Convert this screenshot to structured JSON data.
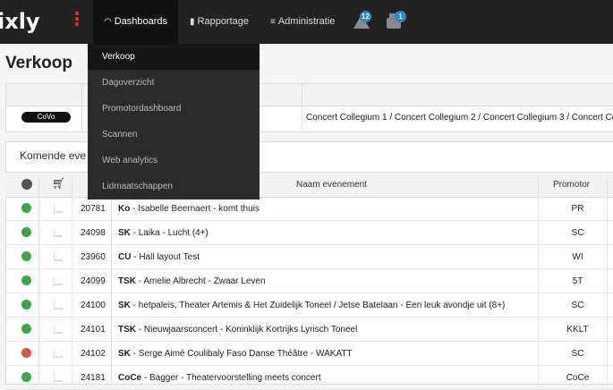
{
  "app": {
    "logo": "ixly",
    "nav": [
      {
        "label": "Dashboards",
        "icon": "gauge-icon"
      },
      {
        "label": "Rapportage",
        "icon": "bar-chart-icon"
      },
      {
        "label": "Administratie",
        "icon": "database-icon"
      }
    ],
    "alerts_badge": "12",
    "print_badge": "1"
  },
  "dropdown": {
    "items": [
      "Verkoop",
      "Dagoverzicht",
      "Promotordashboard",
      "Scannen",
      "Web analytics",
      "Lidmaatschappen"
    ],
    "active": "Verkoop"
  },
  "page": {
    "title": "Verkoop",
    "info": {
      "tag": "CoVo",
      "venues": "Concert Collegium 1 / Concert Collegium 2 / Concert Collegium 3 / Concert Colleg"
    }
  },
  "events": {
    "title": "Komende eve",
    "headers": {
      "name": "Naam evenement",
      "promotor": "Promotor"
    },
    "rows": [
      {
        "id": "20781",
        "code": "Ko",
        "name": " - Isabelle Beernaert - komt thuis",
        "promotor": "PR",
        "status": "online"
      },
      {
        "id": "24098",
        "code": "SK",
        "name": " - Laika - Lucht (4+)",
        "promotor": "SC",
        "status": "online"
      },
      {
        "id": "23960",
        "code": "CU",
        "name": " - Hall layout Test",
        "promotor": "WI",
        "status": "online"
      },
      {
        "id": "24099",
        "code": "TSK",
        "name": " - Amelie Albrecht - Zwaar Leven",
        "promotor": "5T",
        "status": "online"
      },
      {
        "id": "24100",
        "code": "SK",
        "name": " - hetpaleis, Theater Artemis & Het Zuidelijk Toneel / Jetse Batelaan - Een leuk avondje uit (8+)",
        "promotor": "SC",
        "status": "online"
      },
      {
        "id": "24101",
        "code": "TSK",
        "name": " - Nieuwjaarsconcert - Koninklijk Kortrijks Lyrisch Toneel",
        "promotor": "KKLT",
        "status": "online"
      },
      {
        "id": "24102",
        "code": "SK",
        "name": " - Serge Aimé Coulibaly Faso Danse Théâtre - WAKATT",
        "promotor": "SC",
        "status": "offline"
      },
      {
        "id": "24181",
        "code": "CoCe",
        "name": " - Bagger - Theatervoorstelling meets concert",
        "promotor": "CoCe",
        "status": "online"
      }
    ]
  },
  "colors": {
    "online": "#3aa64a",
    "offline": "#d9534f",
    "accent": "#2a87d0",
    "brand": "#e02b2b"
  }
}
